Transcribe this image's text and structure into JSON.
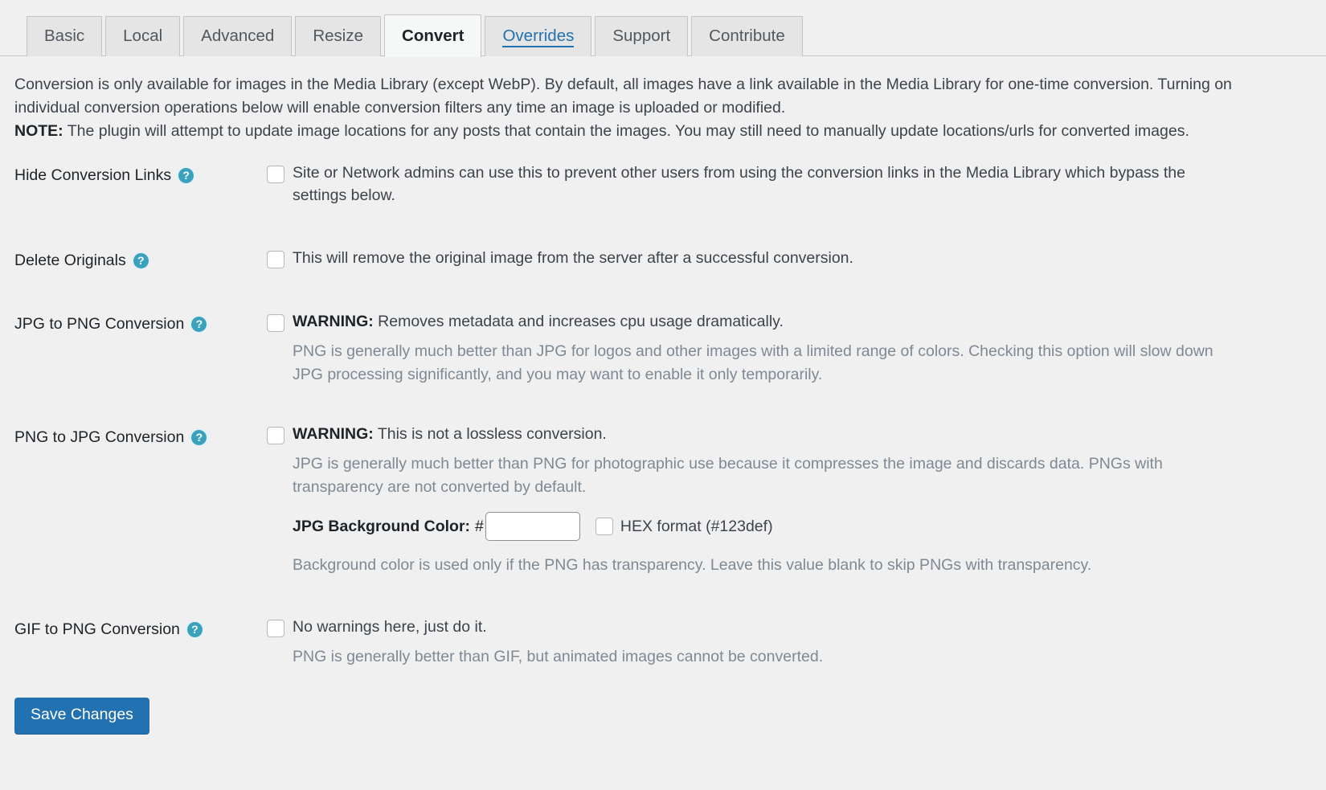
{
  "tabs": [
    {
      "label": "Basic",
      "state": "inactive"
    },
    {
      "label": "Local",
      "state": "inactive"
    },
    {
      "label": "Advanced",
      "state": "inactive"
    },
    {
      "label": "Resize",
      "state": "inactive"
    },
    {
      "label": "Convert",
      "state": "active"
    },
    {
      "label": "Overrides",
      "state": "link"
    },
    {
      "label": "Support",
      "state": "inactive"
    },
    {
      "label": "Contribute",
      "state": "inactive"
    }
  ],
  "intro": {
    "paragraph": "Conversion is only available for images in the Media Library (except WebP). By default, all images have a link available in the Media Library for one-time conversion. Turning on individual conversion operations below will enable conversion filters any time an image is uploaded or modified.",
    "note_prefix": "NOTE:",
    "note_text": " The plugin will attempt to update image locations for any posts that contain the images. You may still need to manually update locations/urls for converted images."
  },
  "settings": {
    "hide_conversion_links": {
      "label": "Hide Conversion Links",
      "help_icon": "help-circle-icon",
      "checkbox_checked": false,
      "checkbox_text": "Site or Network admins can use this to prevent other users from using the conversion links in the Media Library which bypass the settings below."
    },
    "delete_originals": {
      "label": "Delete Originals",
      "help_icon": "help-circle-icon",
      "checkbox_checked": false,
      "checkbox_text": "This will remove the original image from the server after a successful conversion."
    },
    "jpg_to_png": {
      "label": "JPG to PNG Conversion",
      "help_icon": "help-circle-icon",
      "checkbox_checked": false,
      "warning_prefix": "WARNING:",
      "warning_text": " Removes metadata and increases cpu usage dramatically.",
      "description": "PNG is generally much better than JPG for logos and other images with a limited range of colors. Checking this option will slow down JPG processing significantly, and you may want to enable it only temporarily."
    },
    "png_to_jpg": {
      "label": "PNG to JPG Conversion",
      "help_icon": "help-circle-icon",
      "checkbox_checked": false,
      "warning_prefix": "WARNING:",
      "warning_text": " This is not a lossless conversion.",
      "description": "JPG is generally much better than PNG for photographic use because it compresses the image and discards data. PNGs with transparency are not converted by default.",
      "bg_color_label": "JPG Background Color:",
      "bg_color_hash": "#",
      "bg_color_value": "",
      "bg_color_placeholder": "",
      "hex_checkbox_checked": false,
      "hex_label": "HEX format (#123def)",
      "bg_color_note": "Background color is used only if the PNG has transparency. Leave this value blank to skip PNGs with transparency."
    },
    "gif_to_png": {
      "label": "GIF to PNG Conversion",
      "help_icon": "help-circle-icon",
      "checkbox_checked": false,
      "checkbox_text": "No warnings here, just do it.",
      "description": "PNG is generally better than GIF, but animated images cannot be converted."
    }
  },
  "submit": {
    "save_label": "Save Changes"
  },
  "colors": {
    "accent": "#2271b1",
    "help_icon": "#3aa2bd",
    "page_bg": "#f0f0f1",
    "text": "#3c434a",
    "muted_text": "#7e8993"
  }
}
